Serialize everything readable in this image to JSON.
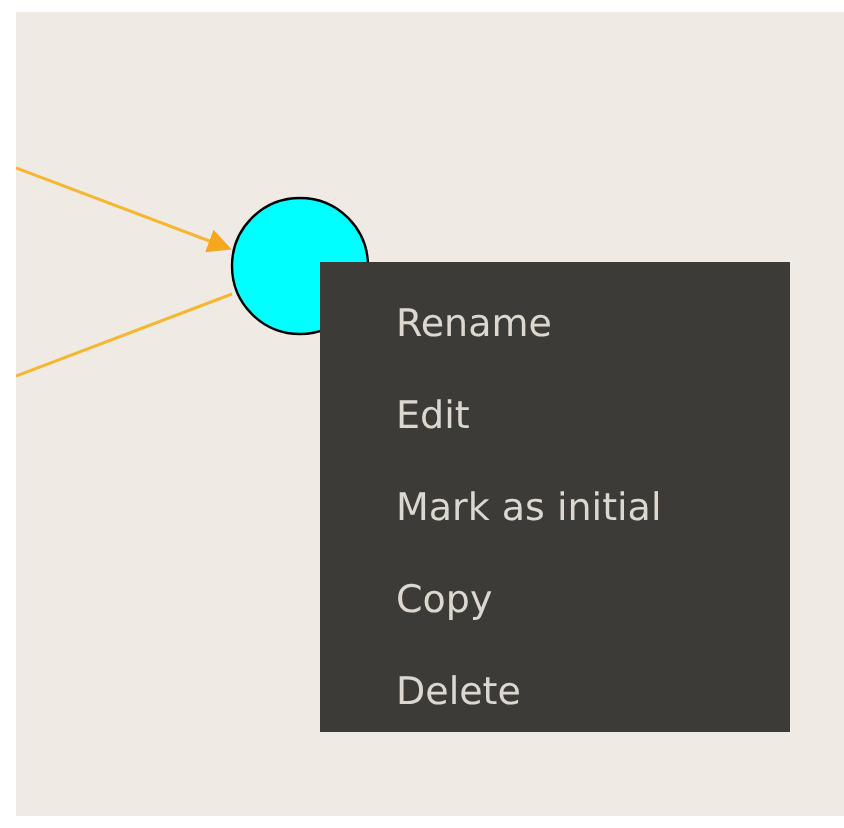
{
  "context_menu": {
    "items": [
      {
        "label": "Rename"
      },
      {
        "label": "Edit"
      },
      {
        "label": "Mark as initial"
      },
      {
        "label": "Copy"
      },
      {
        "label": "Delete"
      }
    ]
  }
}
